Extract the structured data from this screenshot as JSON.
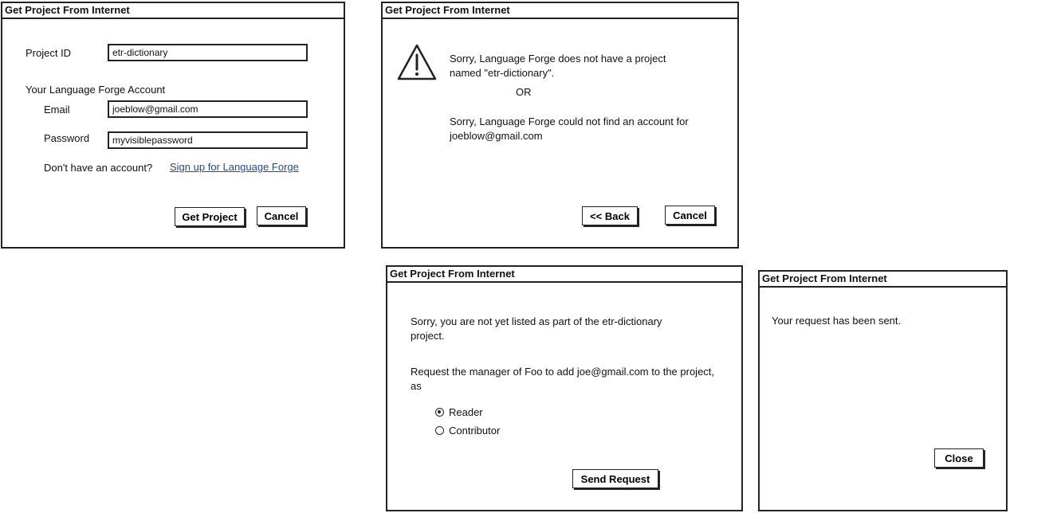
{
  "dialog_title": "Get Project From Internet",
  "get_project": {
    "project_id_label": "Project ID",
    "project_id_value": "etr-dictionary",
    "account_heading": "Your Language Forge Account",
    "email_label": "Email",
    "email_value": "joeblow@gmail.com",
    "password_label": "Password",
    "password_value": "myvisiblepassword",
    "no_account_text": "Don't have an account?",
    "signup_link": "Sign up for Language Forge",
    "get_project_button": "Get Project",
    "cancel_button": "Cancel"
  },
  "error": {
    "icon": "warning-icon",
    "message_project_line1": "Sorry, Language Forge does not have a project",
    "message_project_line2": "named \"etr-dictionary\".",
    "or_text": "OR",
    "message_account_line1": "Sorry, Language Forge could not find an account for",
    "message_account_line2": "joeblow@gmail.com",
    "back_button": "<< Back",
    "cancel_button": "Cancel"
  },
  "request": {
    "not_listed_line1": "Sorry, you are not yet listed as part of the etr-dictionary",
    "not_listed_line2": "project.",
    "request_line1": "Request the manager of Foo to add joe@gmail.com to the project,",
    "request_line2": "as",
    "roles": [
      {
        "label": "Reader",
        "selected": true
      },
      {
        "label": "Contributor",
        "selected": false
      }
    ],
    "send_button": "Send Request"
  },
  "sent": {
    "message": "Your request has been sent.",
    "close_button": "Close"
  }
}
